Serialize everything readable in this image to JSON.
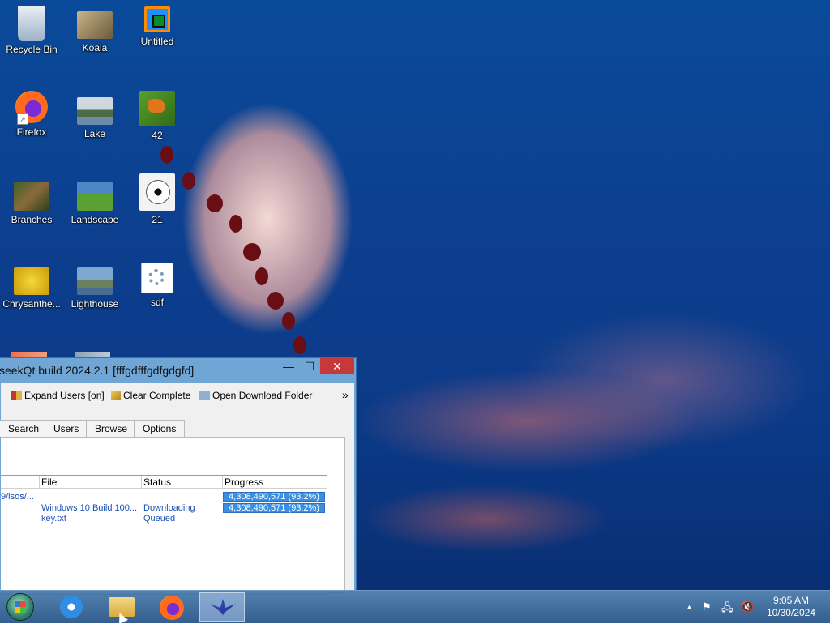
{
  "desktop": {
    "icons": [
      {
        "label": "Recycle Bin",
        "icon": "recycle-bin-icon"
      },
      {
        "label": "Koala",
        "icon": "image-file-icon"
      },
      {
        "label": "Untitled",
        "icon": "image-file-icon"
      },
      {
        "label": "Firefox",
        "icon": "firefox-icon"
      },
      {
        "label": "Lake",
        "icon": "image-file-icon"
      },
      {
        "label": "42",
        "icon": "image-file-icon"
      },
      {
        "label": "Branches",
        "icon": "image-file-icon"
      },
      {
        "label": "Landscape",
        "icon": "image-file-icon"
      },
      {
        "label": "21",
        "icon": "image-file-icon"
      },
      {
        "label": "Chrysanthe...",
        "icon": "image-file-icon"
      },
      {
        "label": "Lighthouse",
        "icon": "image-file-icon"
      },
      {
        "label": "sdf",
        "icon": "settings-file-icon"
      }
    ]
  },
  "window": {
    "title": "seekQt build 2024.2.1 [fffgdfffgdfgdgfd]",
    "controls": {
      "minimize": "—",
      "maximize": "☐",
      "close": "✕"
    },
    "toolbar": {
      "expand_users": "Expand Users [on]",
      "clear_complete": "Clear Complete",
      "open_folder": "Open Download Folder",
      "overflow": "»"
    },
    "tabs": [
      "Search",
      "Users",
      "Browse",
      "Options"
    ],
    "columns": {
      "file": "File",
      "status": "Status",
      "progress": "Progress"
    },
    "rows": [
      {
        "path": "9/isos/...",
        "file": "Windows 10 Build 100...",
        "status": "Downloading",
        "progress": "4,308,490,571 (93.2%)"
      },
      {
        "path": "",
        "file": "key.txt",
        "status": "Queued",
        "progress": "4,308,490,571 (93.2%)"
      }
    ]
  },
  "taskbar": {
    "clock_time": "9:05 AM",
    "clock_date": "10/30/2024",
    "tray_chevron": "▲"
  }
}
